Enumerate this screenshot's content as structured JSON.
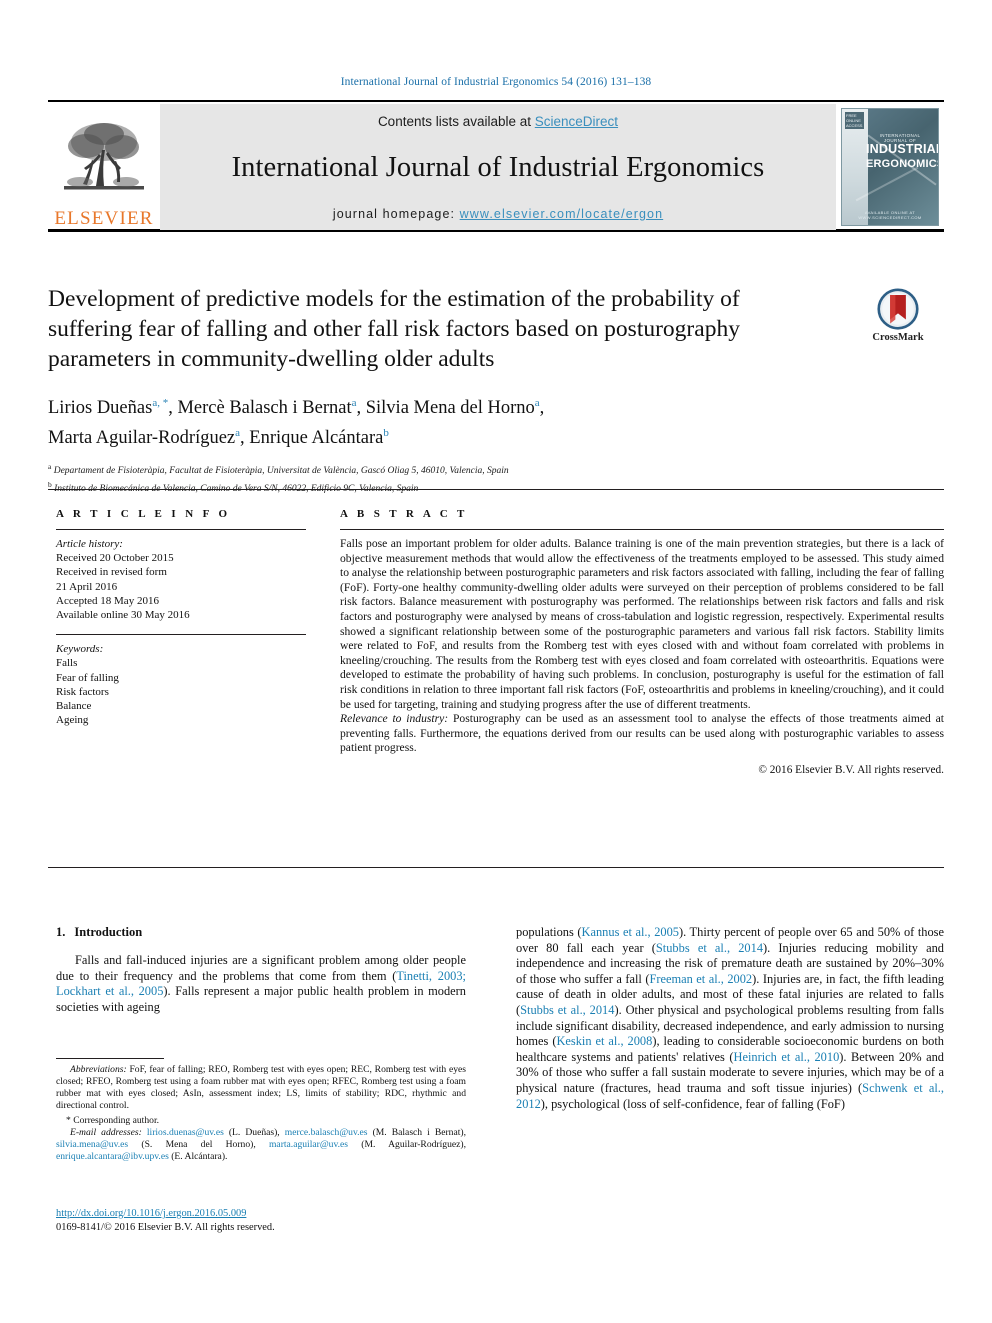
{
  "running_head": "International Journal of Industrial Ergonomics 54 (2016) 131–138",
  "masthead": {
    "contents_prefix": "Contents lists available at ",
    "sciencedirect": "ScienceDirect",
    "journal_title": "International Journal of Industrial Ergonomics",
    "homepage_label": "journal homepage:",
    "homepage_url": "www.elsevier.com/locate/ergon",
    "publisher_wordmark": "ELSEVIER",
    "cover": {
      "kicker": "INTERNATIONAL JOURNAL OF",
      "line1": "INDUSTRIAL",
      "line2": "ERGONOMICS",
      "badge": "FREE ONLINE ACCESS",
      "footer": "AVAILABLE ONLINE AT WWW.SCIENCEDIRECT.COM"
    },
    "accent_link_color": "#3a8fbd",
    "elsevier_orange": "#E8772A"
  },
  "crossmark": {
    "label": "CrossMark"
  },
  "article": {
    "title": "Development of predictive models for the estimation of the probability of suffering fear of falling and other fall risk factors based on posturography parameters in community-dwelling older adults",
    "authors_line1": "Lirios Dueñas",
    "authors_line1_marks": "a, *",
    "authors_line1_b": ", Mercè Balasch i Bernat",
    "authors_line1_b_mark": "a",
    "authors_line1_c": ", Silvia Mena del Horno",
    "authors_line1_c_mark": "a",
    "authors_line1_tail": ",",
    "authors_line2": "Marta Aguilar-Rodríguez",
    "authors_line2_mark": "a",
    "authors_line2_b": ", Enrique Alcántara",
    "authors_line2_b_mark": "b",
    "affiliation_a_mark": "a",
    "affiliation_a": "Departament de Fisioteràpia, Facultat de Fisioteràpia, Universitat de València, Gascó Oliag 5, 46010, Valencia, Spain",
    "affiliation_b_mark": "b",
    "affiliation_b": "Instituto de Biomecánica de Valencia, Camino de Vera S/N, 46022, Edificio 9C, Valencia, Spain"
  },
  "article_info": {
    "heading": "A R T I C L E  I N F O",
    "history_label": "Article history:",
    "history": [
      "Received 20 October 2015",
      "Received in revised form",
      "21 April 2016",
      "Accepted 18 May 2016",
      "Available online 30 May 2016"
    ],
    "keywords_label": "Keywords:",
    "keywords": [
      "Falls",
      "Fear of falling",
      "Risk factors",
      "Balance",
      "Ageing"
    ]
  },
  "abstract": {
    "heading": "A B S T R A C T",
    "text": "Falls pose an important problem for older adults. Balance training is one of the main prevention strategies, but there is a lack of objective measurement methods that would allow the effectiveness of the treatments employed to be assessed. This study aimed to analyse the relationship between posturographic parameters and risk factors associated with falling, including the fear of falling (FoF). Forty-one healthy community-dwelling older adults were surveyed on their perception of problems considered to be fall risk factors. Balance measurement with posturography was performed. The relationships between risk factors and falls and risk factors and posturography were analysed by means of cross-tabulation and logistic regression, respectively. Experimental results showed a significant relationship between some of the posturographic parameters and various fall risk factors. Stability limits were related to FoF, and results from the Romberg test with eyes closed with and without foam correlated with problems in kneeling/crouching. The results from the Romberg test with eyes closed and foam correlated with osteoarthritis. Equations were developed to estimate the probability of having such problems. In conclusion, posturography is useful for the estimation of fall risk conditions in relation to three important fall risk factors (FoF, osteoarthritis and problems in kneeling/crouching), and it could be used for targeting, training and studying progress after the use of different treatments.",
    "relevance_label": "Relevance to industry:",
    "relevance_text": " Posturography can be used as an assessment tool to analyse the effects of those treatments aimed at preventing falls. Furthermore, the equations derived from our results can be used along with posturographic variables to assess patient progress.",
    "copyright": "© 2016 Elsevier B.V. All rights reserved."
  },
  "introduction": {
    "number": "1.",
    "title": "Introduction",
    "left_paragraph_parts": [
      {
        "t": "Falls and fall-induced injuries are a significant problem among older people due to their frequency and the problems that come from them (",
        "link": false
      },
      {
        "t": "Tinetti, 2003; Lockhart et al., 2005",
        "link": true
      },
      {
        "t": "). Falls represent a major public health problem in modern societies with ageing",
        "link": false
      }
    ],
    "right_paragraph_parts": [
      {
        "t": "populations (",
        "link": false
      },
      {
        "t": "Kannus et al., 2005",
        "link": true
      },
      {
        "t": "). Thirty percent of people over 65 and 50% of those over 80 fall each year (",
        "link": false
      },
      {
        "t": "Stubbs et al., 2014",
        "link": true
      },
      {
        "t": "). Injuries reducing mobility and independence and increasing the risk of premature death are sustained by 20%–30% of those who suffer a fall (",
        "link": false
      },
      {
        "t": "Freeman et al., 2002",
        "link": true
      },
      {
        "t": "). Injuries are, in fact, the fifth leading cause of death in older adults, and most of these fatal injuries are related to falls (",
        "link": false
      },
      {
        "t": "Stubbs et al., 2014",
        "link": true
      },
      {
        "t": "). Other physical and psychological problems resulting from falls include significant disability, decreased independence, and early admission to nursing homes (",
        "link": false
      },
      {
        "t": "Keskin et al., 2008",
        "link": true
      },
      {
        "t": "), leading to considerable socioeconomic burdens on both healthcare systems and patients' relatives (",
        "link": false
      },
      {
        "t": "Heinrich et al., 2010",
        "link": true
      },
      {
        "t": "). Between 20% and 30% of those who suffer a fall sustain moderate to severe injuries, which may be of a physical nature (fractures, head trauma and soft tissue injuries) (",
        "link": false
      },
      {
        "t": "Schwenk et al., 2012",
        "link": true
      },
      {
        "t": "), psychological (loss of self-confidence, fear of falling (FoF)",
        "link": false
      }
    ]
  },
  "footnotes": {
    "abbreviations_label": "Abbreviations:",
    "abbreviations_text": " FoF, fear of falling; REO, Romberg test with eyes open; REC, Romberg test with eyes closed; RFEO, Romberg test using a foam rubber mat with eyes open; RFEC, Romberg test using a foam rubber mat with eyes closed; AsIn, assessment index; LS, limits of stability; RDC, rhythmic and directional control.",
    "corresponding_star": "*",
    "corresponding_text": "Corresponding author.",
    "email_label": "E-mail addresses:",
    "emails": [
      {
        "addr": "lirios.duenas@uv.es",
        "name": "(L. Dueñas)"
      },
      {
        "addr": "merce.balasch@uv.es",
        "name": "(M. Balasch i Bernat)"
      },
      {
        "addr": "silvia.mena@uv.es",
        "name": "(S. Mena del Horno)"
      },
      {
        "addr": "marta.aguilar@uv.es",
        "name": "(M. Aguilar-Rodríguez)"
      },
      {
        "addr": "enrique.alcantara@ibv.upv.es",
        "name": "(E. Alcántara)"
      }
    ]
  },
  "doi": {
    "url": "http://dx.doi.org/10.1016/j.ergon.2016.05.009",
    "issn_line": "0169-8141/© 2016 Elsevier B.V. All rights reserved."
  }
}
